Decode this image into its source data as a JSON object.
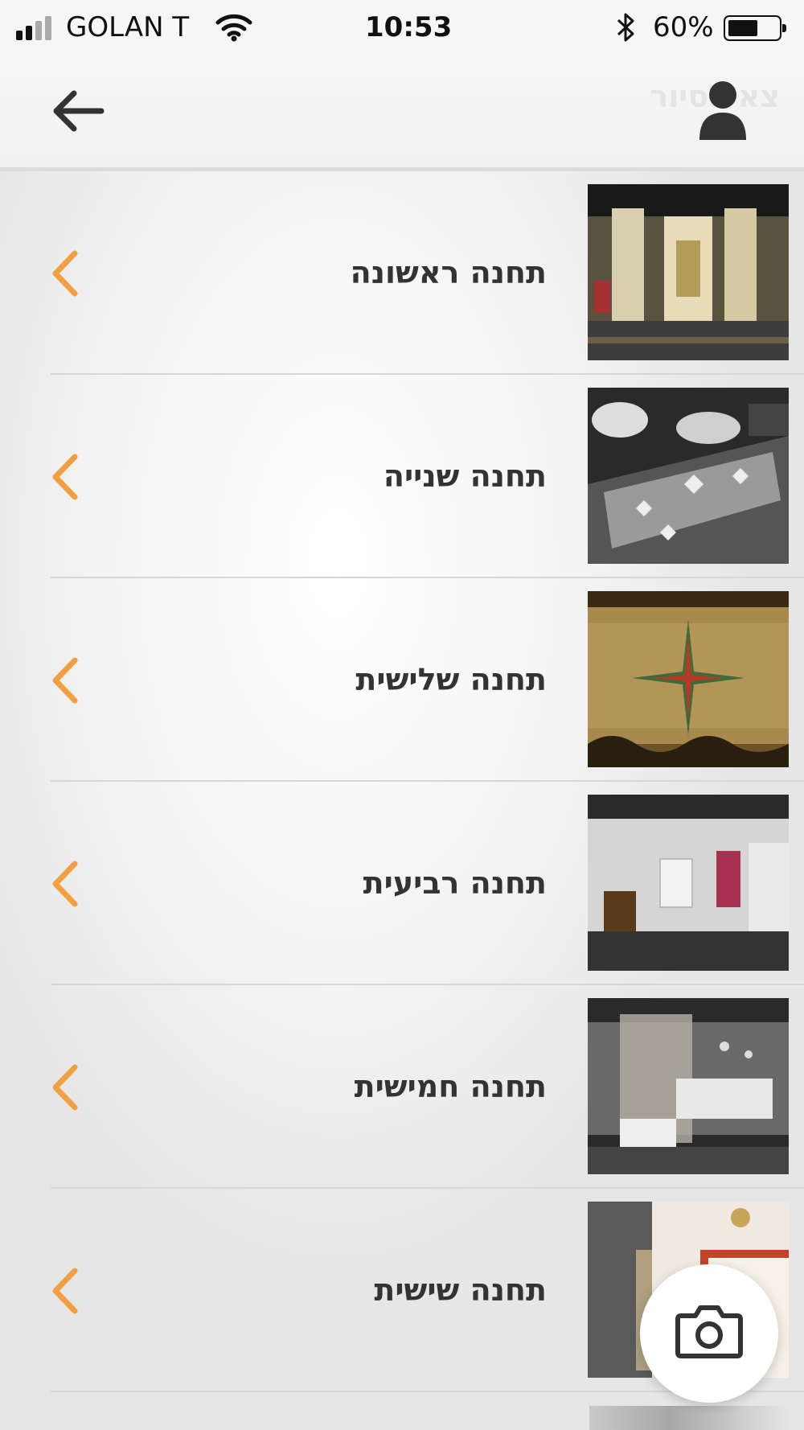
{
  "status_bar": {
    "carrier": "GOLAN T",
    "time": "10:53",
    "battery": "60%",
    "battery_level": 0.6
  },
  "header": {
    "title": "צא לסיור",
    "back_icon": "arrow-left-icon",
    "profile_icon": "user-icon"
  },
  "colors": {
    "accent": "#f0a040",
    "text": "#333333",
    "header_bg": "#f4f4f4"
  },
  "stations": [
    {
      "label": "תחנה ראשונה",
      "thumb": "museum-hall-round-display"
    },
    {
      "label": "תחנה שנייה",
      "thumb": "hands-on-embroidered-textile"
    },
    {
      "label": "תחנה שלישית",
      "thumb": "wooden-chest-with-star"
    },
    {
      "label": "תחנה רביעית",
      "thumb": "gallery-with-chair-and-vitrines"
    },
    {
      "label": "תחנה חמישית",
      "thumb": "glass-vitrines-silver-objects"
    },
    {
      "label": "תחנה שישית",
      "thumb": "exhibition-entrance-wall"
    }
  ],
  "fab": {
    "icon": "camera-icon"
  }
}
